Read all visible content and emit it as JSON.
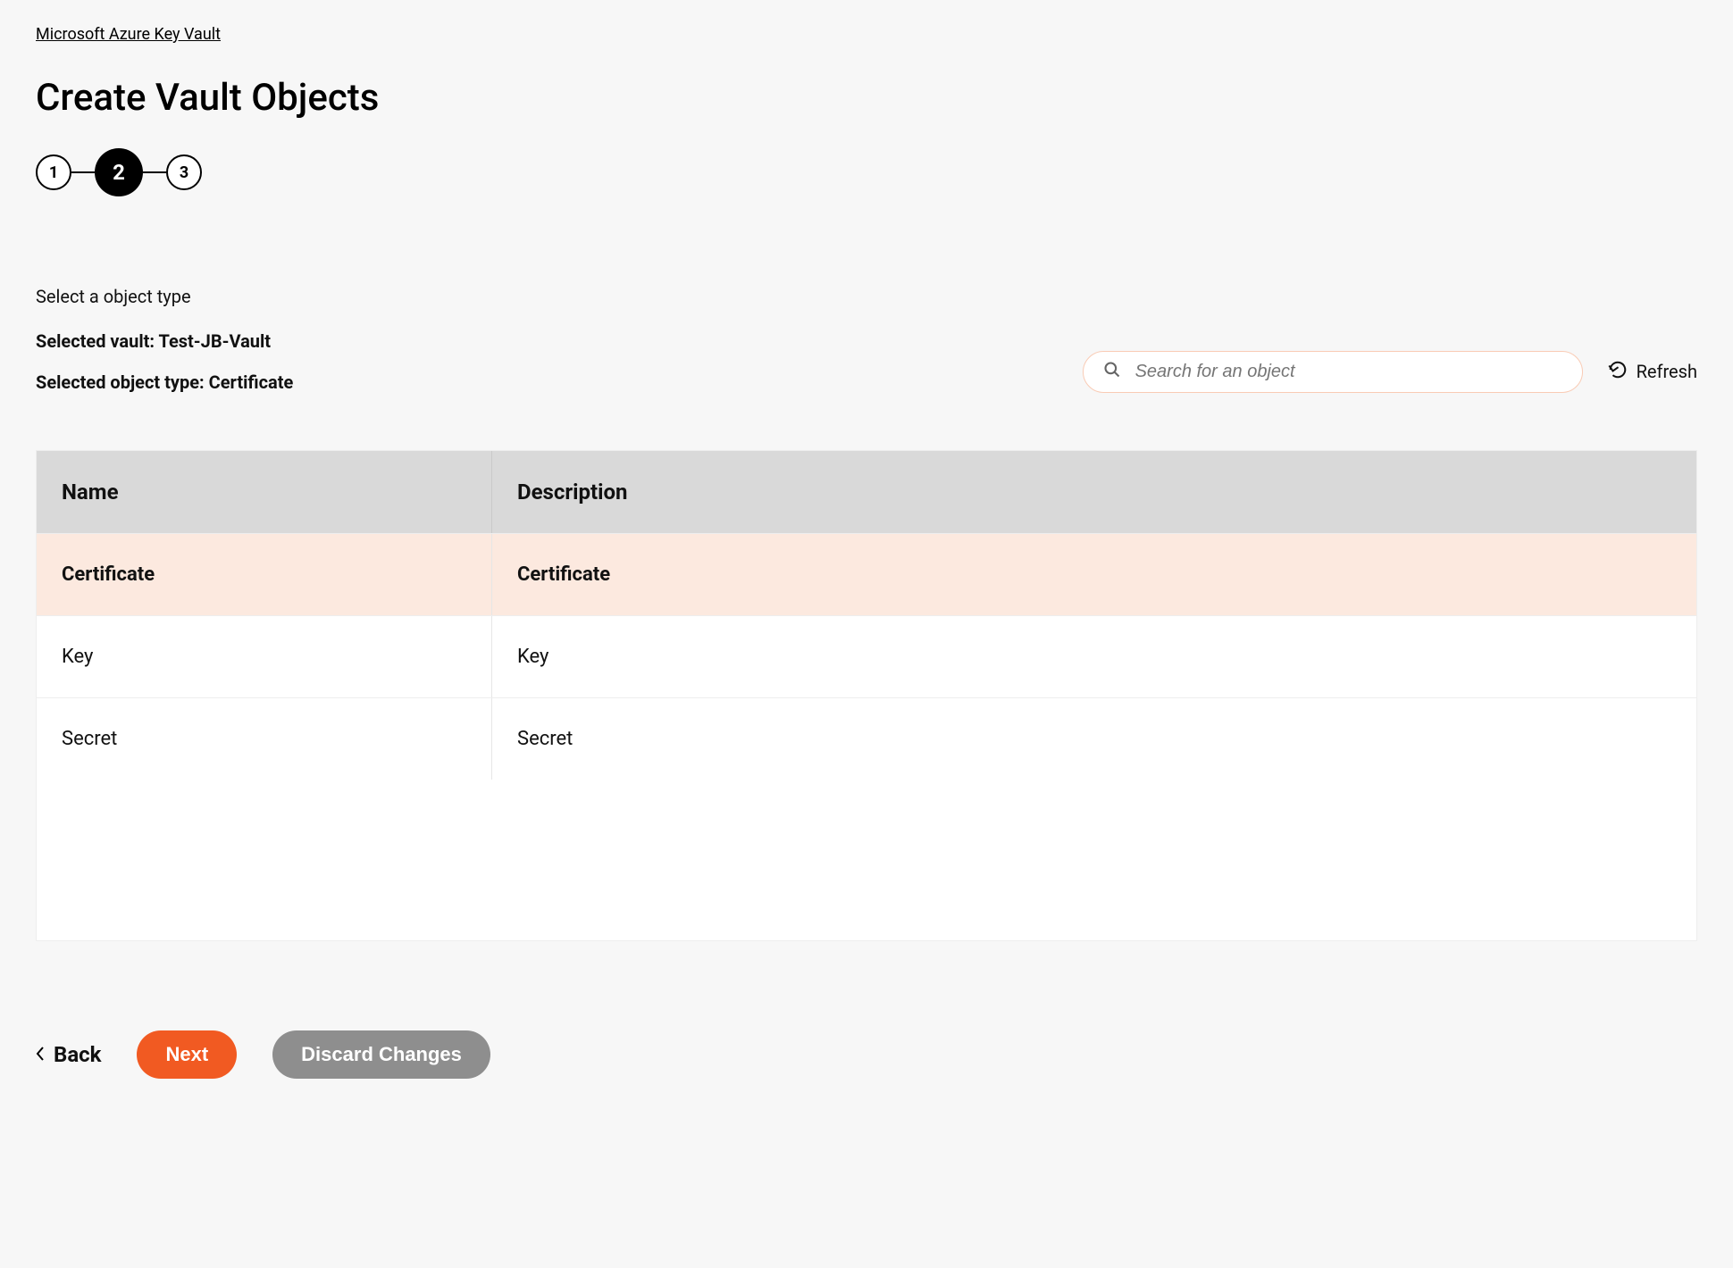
{
  "breadcrumb": "Microsoft Azure Key Vault",
  "title": "Create Vault Objects",
  "stepper": {
    "steps": [
      "1",
      "2",
      "3"
    ],
    "active_index": 1
  },
  "instruction": "Select a object type",
  "selected_vault_label": "Selected vault: Test-JB-Vault",
  "selected_object_type_label": "Selected object type: Certificate",
  "search": {
    "placeholder": "Search for an object"
  },
  "refresh_label": "Refresh",
  "table": {
    "columns": {
      "name": "Name",
      "description": "Description"
    },
    "rows": [
      {
        "name": "Certificate",
        "description": "Certificate",
        "selected": true
      },
      {
        "name": "Key",
        "description": "Key",
        "selected": false
      },
      {
        "name": "Secret",
        "description": "Secret",
        "selected": false
      }
    ]
  },
  "footer": {
    "back": "Back",
    "next": "Next",
    "discard": "Discard Changes"
  }
}
